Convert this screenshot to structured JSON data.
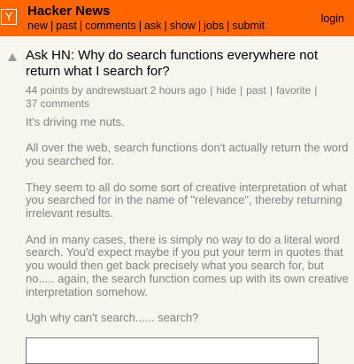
{
  "header": {
    "logo_letter": "Y",
    "site_name": "Hacker News",
    "nav": [
      "new",
      "past",
      "comments",
      "ask",
      "show",
      "jobs",
      "submit"
    ],
    "login": "login"
  },
  "story": {
    "title": "Ask HN: Why do search functions everywhere not return what I search for?",
    "points": "44 points",
    "by": "by",
    "author": "andrewstuart",
    "age": "2 hours ago",
    "hide": "hide",
    "past": "past",
    "favorite": "favorite",
    "comments": "37 comments",
    "text": [
      "It's driving me nuts.",
      "All over the web, search functions don't actually return the word you searched for.",
      "They seem to all do some sort of creative interpretation of what you searched for in the name of \"relevance\", thereby returning irrelevant results.",
      "And in many cases, there is simply no way to do a literal word search. You'd expect maybe if you put your term in quotes that you would then get back precisely what you search for, but no..... again, the search function comes up with its own creative interpretation somehow.",
      "Ugh why can't search...... search?"
    ]
  },
  "reply": {
    "value": ""
  },
  "icons": {
    "logo": "y-logo-icon",
    "vote": "upvote-arrow-icon"
  },
  "colors": {
    "header": "#ff6600",
    "background": "#f6f6ef",
    "subtext": "#828282"
  }
}
